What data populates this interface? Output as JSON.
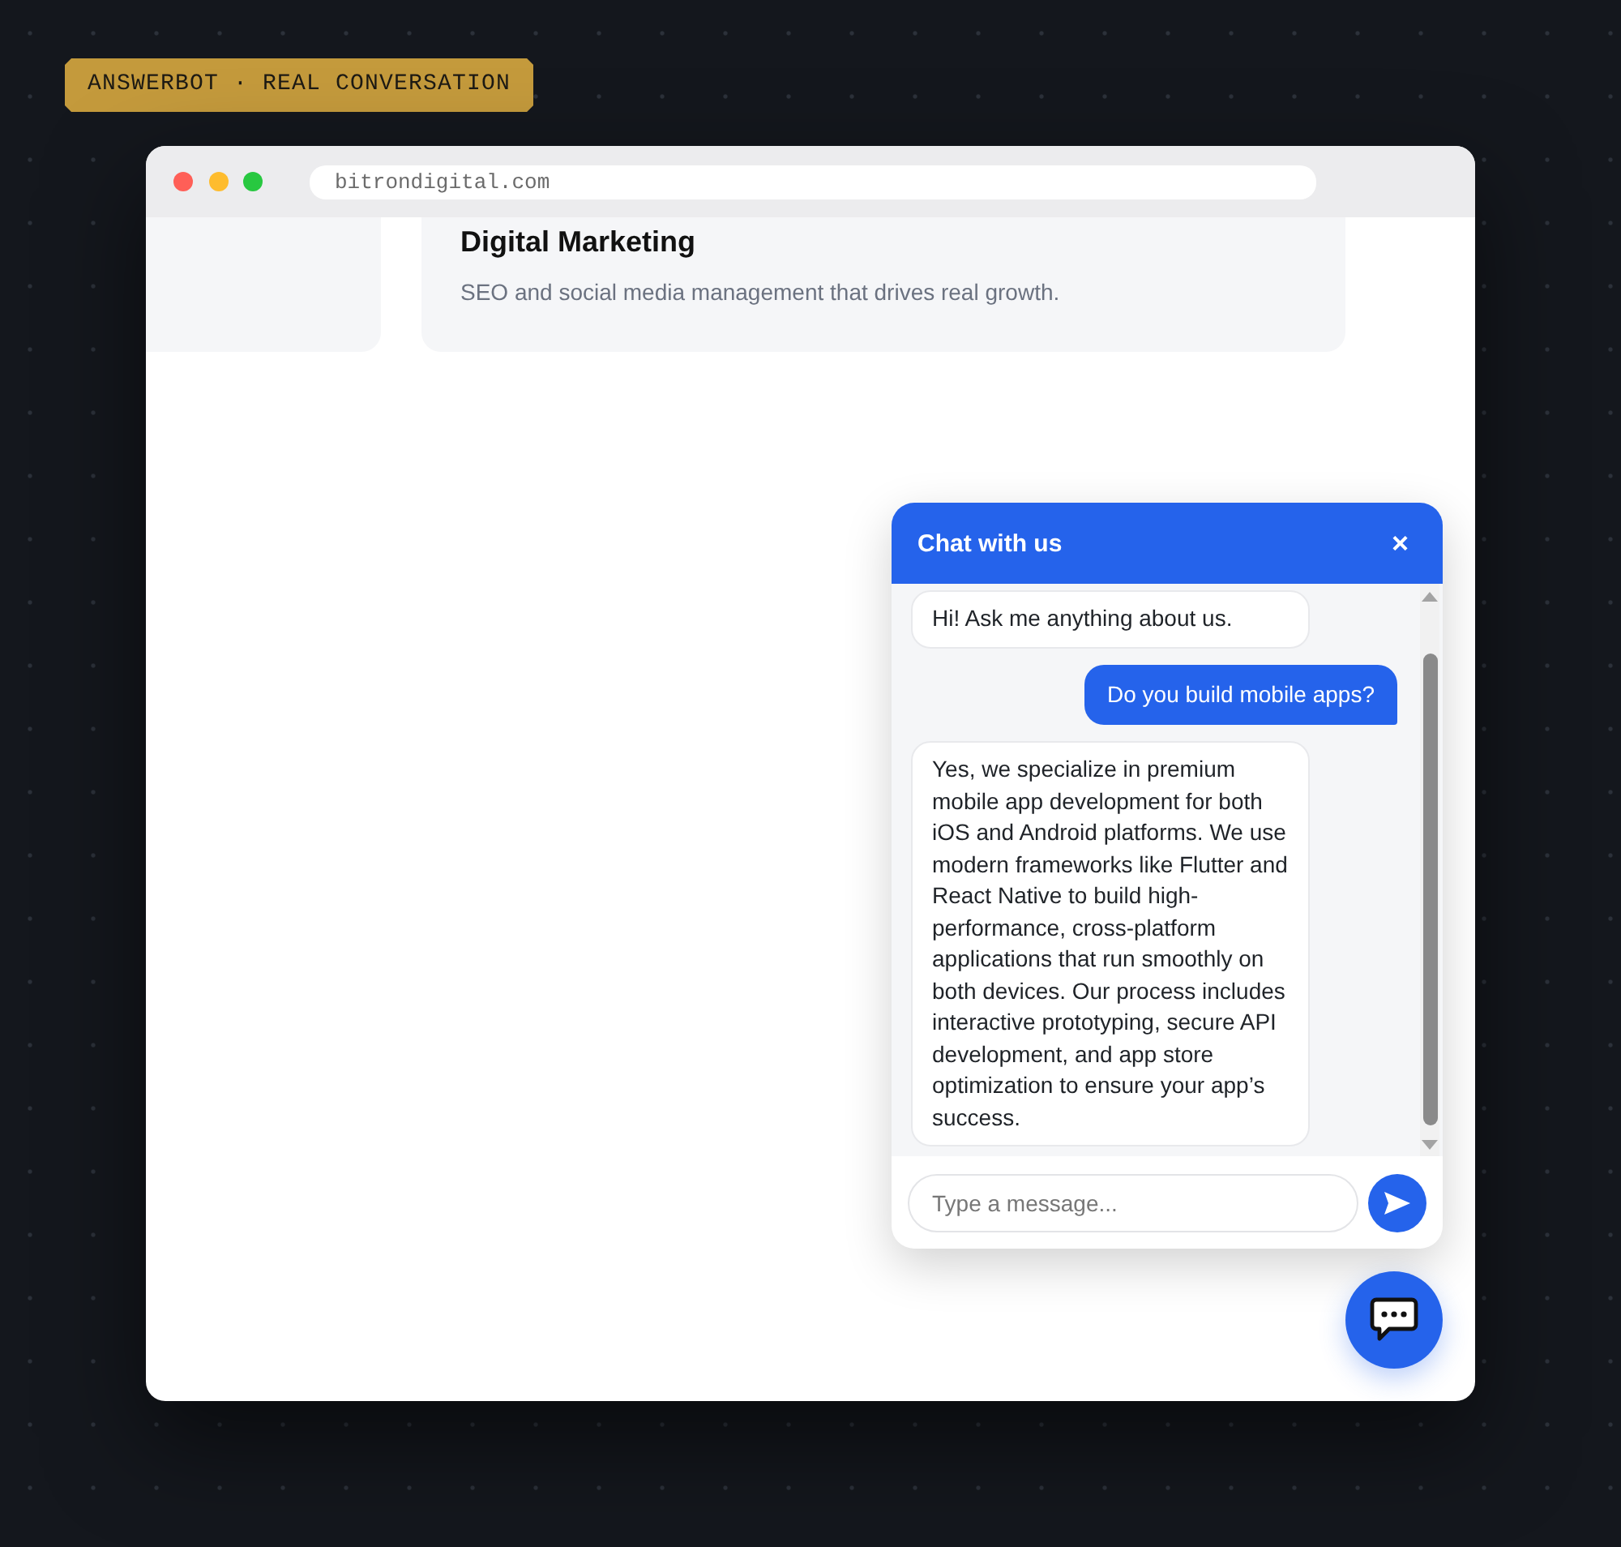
{
  "badge": {
    "text": "ANSWERBOT · REAL CONVERSATION"
  },
  "browser": {
    "url": "bitrondigital.com"
  },
  "page": {
    "card": {
      "title": "Digital Marketing",
      "description": "SEO and social media management that drives real growth."
    }
  },
  "chat": {
    "title": "Chat with us",
    "close": "×",
    "messages": [
      {
        "kind": "bot",
        "text": "Hi! Ask me anything about us."
      },
      {
        "kind": "user",
        "text": "Do you build mobile apps?"
      },
      {
        "kind": "bot",
        "text": "Yes, we specialize in premium mobile app development for both iOS and Android platforms. We use modern frameworks like Flutter and React Native to build high-performance, cross-platform applications that run smoothly on both devices. Our process includes interactive prototyping, secure API development, and app store optimization to ensure your app’s success."
      }
    ],
    "input": {
      "placeholder": "Type a message..."
    }
  }
}
